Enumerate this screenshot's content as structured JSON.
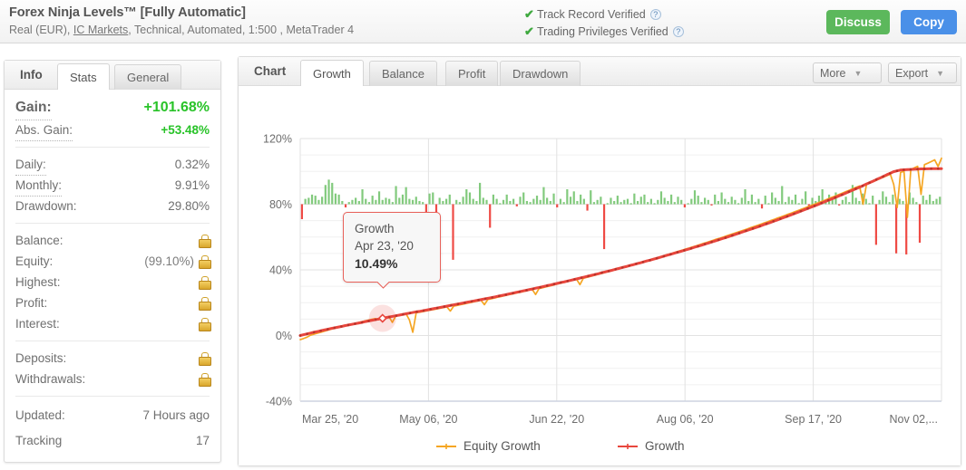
{
  "header": {
    "title": "Forex Ninja Levels™ [Fully Automatic]",
    "sub_pre": "Real (EUR), ",
    "broker_link": "IC Markets",
    "sub_post": ", Technical, Automated, 1:500 , MetaTrader 4",
    "verified": [
      {
        "label": "Track Record Verified",
        "check": "✔",
        "help": "?"
      },
      {
        "label": "Trading Privileges Verified",
        "check": "✔",
        "help": "?"
      }
    ],
    "discuss_label": "Discuss",
    "copy_label": "Copy",
    "discuss_color": "#5cb85c",
    "copy_color": "#4a90e8"
  },
  "sidebar": {
    "tabs": [
      {
        "label": "Info",
        "type": "static"
      },
      {
        "label": "Stats",
        "active": true
      },
      {
        "label": "General",
        "active": false
      }
    ],
    "groups": [
      {
        "rows": [
          {
            "key": "Gain:",
            "value": "+101.68%",
            "big": true,
            "dotted": true
          },
          {
            "key": "Abs. Gain:",
            "value": "+53.48%",
            "green": true,
            "dotted": true
          }
        ]
      },
      {
        "rows": [
          {
            "key": "Daily:",
            "value": "0.32%",
            "dotted": true
          },
          {
            "key": "Monthly:",
            "value": "9.91%",
            "dotted": true
          },
          {
            "key": "Drawdown:",
            "value": "29.80%"
          }
        ]
      },
      {
        "rows": [
          {
            "key": "Balance:",
            "value": "",
            "lock": true
          },
          {
            "key": "Equity:",
            "value": "(99.10%)",
            "lock": true
          },
          {
            "key": "Highest:",
            "value": "",
            "lock": true
          },
          {
            "key": "Profit:",
            "value": "",
            "lock": true
          },
          {
            "key": "Interest:",
            "value": "",
            "lock": true
          }
        ]
      },
      {
        "rows": [
          {
            "key": "Deposits:",
            "value": "",
            "lock": true
          },
          {
            "key": "Withdrawals:",
            "value": "",
            "lock": true
          }
        ]
      },
      {
        "rows": [
          {
            "key": "Updated:",
            "value": "7 Hours ago"
          },
          {
            "key": "Tracking",
            "value": "17"
          }
        ]
      }
    ]
  },
  "chart_panel": {
    "tabs": [
      {
        "label": "Chart",
        "type": "static"
      },
      {
        "label": "Growth",
        "active": true
      },
      {
        "label": "Balance",
        "active": false
      },
      {
        "label": "Profit",
        "active": false
      },
      {
        "label": "Drawdown",
        "active": false
      }
    ],
    "more_label": "More",
    "export_label": "Export",
    "caret": "▼"
  },
  "tooltip": {
    "series": "Growth",
    "date": "Apr 23, '20",
    "value": "10.49%"
  },
  "chart_data": {
    "type": "line",
    "title": "Growth",
    "xlabel": "",
    "ylabel": "",
    "ylim": [
      -40,
      120
    ],
    "yticks": [
      -40,
      0,
      40,
      80,
      120
    ],
    "ytick_labels": [
      "-40%",
      "0%",
      "40%",
      "80%",
      "120%"
    ],
    "minor_tick_step": 10,
    "grid": true,
    "legend_position": "bottom",
    "xtick_labels": [
      "Mar 25, '20",
      "May 06, '20",
      "Jun 22, '20",
      "Aug 06, '20",
      "Sep 17, '20",
      "Nov 02,..."
    ],
    "x_start": "Mar 25, '20",
    "x_end": "Nov 02, '20",
    "series": [
      {
        "name": "Equity Growth",
        "color": "#f5a623",
        "values": [
          -2.5,
          -1.8,
          -1.0,
          0.2,
          0.8,
          1.4,
          2.0,
          2.6,
          3.2,
          3.8,
          4.3,
          4.9,
          5.4,
          6.0,
          6.4,
          6.9,
          7.4,
          7.9,
          8.4,
          8.9,
          9.4,
          9.9,
          10.3,
          9.6,
          10.5,
          11.1,
          11.6,
          8.0,
          11.9,
          12.4,
          12.9,
          13.3,
          9.5,
          2.0,
          13.9,
          14.2,
          14.6,
          15.0,
          15.4,
          15.8,
          16.2,
          16.6,
          17.0,
          17.4,
          14.9,
          17.9,
          18.3,
          18.8,
          19.2,
          19.7,
          20.1,
          20.6,
          21.0,
          21.5,
          18.8,
          22.0,
          22.4,
          22.9,
          23.4,
          23.8,
          24.3,
          24.8,
          25.2,
          25.7,
          26.2,
          26.6,
          27.1,
          27.6,
          28.1,
          25.0,
          28.6,
          29.1,
          29.6,
          30.1,
          30.6,
          31.2,
          31.7,
          32.2,
          32.7,
          33.3,
          33.8,
          34.3,
          31.0,
          34.9,
          35.4,
          36.0,
          36.5,
          37.1,
          37.6,
          38.2,
          38.8,
          39.3,
          39.9,
          40.5,
          41.1,
          41.6,
          42.2,
          42.8,
          43.4,
          44.0,
          44.6,
          45.2,
          45.8,
          46.4,
          47.0,
          47.6,
          48.2,
          48.9,
          49.5,
          50.1,
          50.8,
          51.4,
          52.0,
          52.7,
          53.3,
          54.0,
          54.6,
          55.3,
          56.0,
          56.6,
          57.3,
          58.0,
          58.7,
          59.3,
          60.0,
          60.7,
          61.4,
          62.1,
          62.8,
          63.5,
          64.2,
          64.9,
          65.7,
          66.4,
          67.1,
          67.8,
          68.6,
          69.3,
          70.1,
          70.8,
          71.6,
          72.3,
          73.1,
          73.9,
          74.6,
          75.4,
          76.2,
          77.0,
          77.8,
          78.6,
          79.4,
          80.2,
          81.0,
          81.8,
          82.6,
          83.5,
          84.3,
          85.1,
          86.0,
          86.8,
          87.7,
          88.5,
          89.4,
          90.3,
          91.1,
          80.0,
          92.0,
          92.9,
          93.8,
          94.7,
          95.6,
          96.5,
          97.4,
          98.3,
          92.0,
          78.0,
          99.3,
          100.2,
          72.0,
          101.2,
          102.1,
          103.1,
          86.0,
          104.1,
          105.0,
          106.0,
          107.0,
          103.0,
          108.0
        ]
      },
      {
        "name": "Growth",
        "color": "#e8463d",
        "values": [
          0.0,
          0.5,
          1.0,
          1.5,
          2.0,
          2.4,
          2.9,
          3.4,
          3.8,
          4.3,
          4.7,
          5.1,
          5.5,
          6.0,
          6.4,
          6.8,
          7.2,
          7.6,
          8.0,
          8.5,
          8.9,
          9.3,
          9.7,
          10.1,
          10.49,
          10.9,
          11.3,
          11.7,
          12.1,
          12.5,
          12.9,
          13.3,
          13.7,
          14.1,
          14.5,
          14.8,
          15.2,
          15.6,
          16.0,
          16.4,
          16.8,
          17.2,
          17.6,
          18.0,
          18.4,
          18.8,
          19.2,
          19.6,
          20.0,
          20.4,
          20.8,
          21.2,
          21.6,
          22.0,
          22.4,
          22.8,
          23.2,
          23.6,
          24.1,
          24.5,
          24.9,
          25.4,
          25.8,
          26.3,
          26.7,
          27.2,
          27.6,
          28.1,
          28.5,
          29.0,
          29.4,
          29.9,
          30.4,
          30.8,
          31.3,
          31.8,
          32.3,
          32.7,
          33.2,
          33.7,
          34.2,
          34.7,
          35.2,
          35.7,
          36.2,
          36.7,
          37.2,
          37.7,
          38.3,
          38.8,
          39.3,
          39.8,
          40.4,
          40.9,
          41.5,
          42.0,
          42.6,
          43.1,
          43.7,
          44.2,
          44.8,
          45.4,
          45.9,
          46.5,
          47.1,
          47.7,
          48.3,
          48.9,
          49.5,
          50.1,
          50.7,
          51.3,
          51.9,
          52.5,
          53.1,
          53.8,
          54.4,
          55.0,
          55.7,
          56.3,
          57.0,
          57.6,
          58.3,
          59.0,
          59.6,
          60.3,
          61.0,
          61.7,
          62.4,
          63.1,
          63.8,
          64.5,
          65.2,
          65.9,
          66.6,
          67.4,
          68.1,
          68.8,
          69.6,
          70.3,
          71.1,
          71.9,
          72.6,
          73.4,
          74.2,
          75.0,
          75.8,
          76.6,
          77.4,
          78.2,
          79.0,
          79.8,
          80.7,
          81.5,
          82.4,
          83.2,
          84.1,
          85.0,
          85.8,
          86.7,
          87.6,
          88.5,
          89.4,
          90.3,
          91.2,
          92.2,
          93.1,
          94.0,
          95.0,
          95.9,
          96.9,
          97.9,
          98.8,
          99.8,
          100.3,
          100.8,
          101.0,
          101.1,
          101.2,
          101.3,
          101.4,
          101.5,
          101.55,
          101.6,
          101.62,
          101.65,
          101.66,
          101.68
        ]
      }
    ],
    "bars": {
      "name": "Daily Profit/Loss",
      "baseline_percent": 80,
      "positive_color": "#82ca7d",
      "negative_color": "#ef4b45",
      "values": [
        -14,
        5,
        6,
        9,
        8,
        4,
        7,
        18,
        23,
        20,
        10,
        9,
        3,
        -3,
        2,
        4,
        6,
        3,
        14,
        5,
        2,
        8,
        4,
        12,
        4,
        6,
        5,
        2,
        17,
        6,
        9,
        16,
        5,
        4,
        7,
        3,
        2,
        -24,
        10,
        11,
        -60,
        6,
        3,
        5,
        9,
        -52,
        4,
        2,
        7,
        14,
        11,
        5,
        3,
        20,
        6,
        4,
        -22,
        9,
        5,
        1,
        4,
        9,
        3,
        5,
        -2,
        7,
        11,
        3,
        2,
        5,
        8,
        4,
        16,
        6,
        3,
        10,
        -3,
        5,
        2,
        14,
        7,
        12,
        3,
        9,
        5,
        -6,
        13,
        2,
        4,
        7,
        -42,
        1,
        6,
        3,
        8,
        2,
        4,
        5,
        1,
        10,
        3,
        7,
        9,
        2,
        5,
        1,
        4,
        12,
        6,
        3,
        9,
        2,
        7,
        4,
        -3,
        1,
        5,
        13,
        8,
        2,
        6,
        4,
        -1,
        9,
        3,
        11,
        5,
        2,
        7,
        4,
        1,
        6,
        14,
        3,
        9,
        2,
        5,
        -4,
        8,
        1,
        11,
        6,
        3,
        17,
        2,
        7,
        4,
        9,
        1,
        5,
        12,
        -2,
        6,
        3,
        8,
        14,
        2,
        9,
        5,
        11,
        -1,
        4,
        7,
        2,
        18,
        6,
        3,
        10,
        5,
        1,
        8,
        -38,
        4,
        12,
        7,
        2,
        9,
        -46,
        5,
        3,
        -47,
        11,
        6,
        2,
        -36,
        8,
        4,
        9,
        3,
        5,
        7
      ]
    },
    "legend": [
      {
        "label": "Equity Growth",
        "color": "#f5a623"
      },
      {
        "label": "Growth",
        "color": "#e8463d"
      }
    ]
  }
}
